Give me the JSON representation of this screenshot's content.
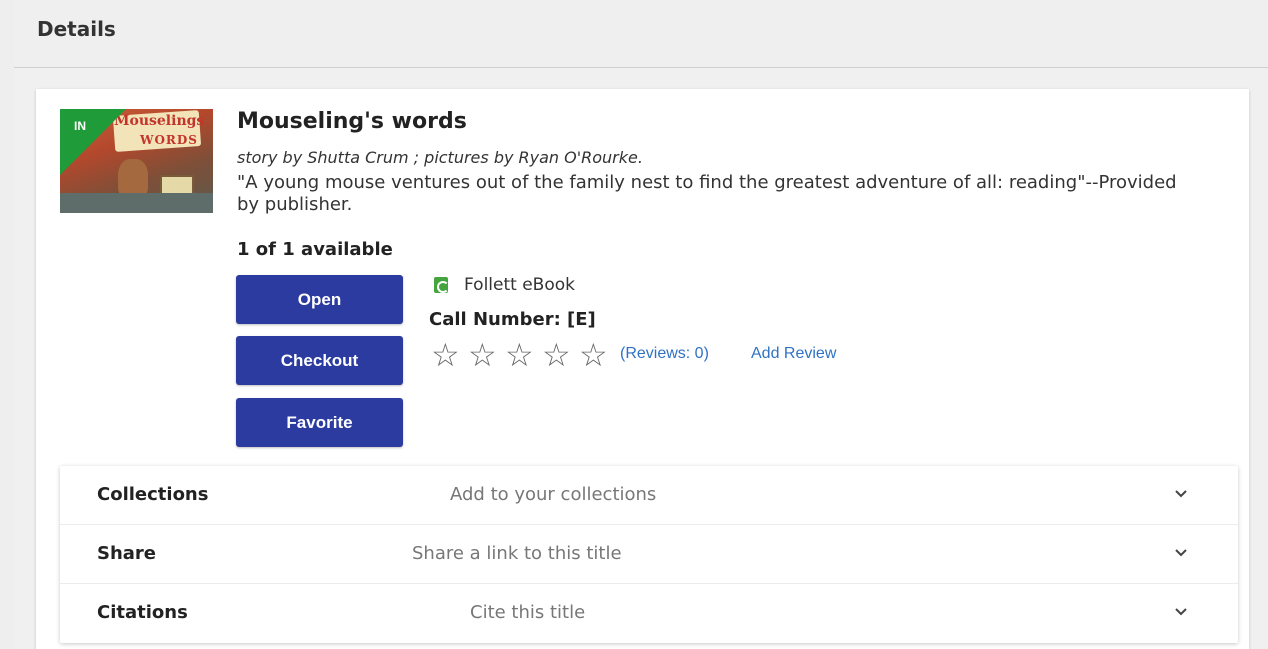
{
  "header": {
    "title": "Details"
  },
  "book": {
    "status_badge": "IN",
    "cover_text_line1": "Mouselings",
    "cover_text_line2": "WORDS",
    "title": "Mouseling's words",
    "byline": "story by Shutta Crum ; pictures by Ryan O'Rourke.",
    "summary": "\"A young mouse ventures out of the family nest to find the greatest adventure of all: reading\"--Provided by publisher.",
    "availability": "1 of 1 available",
    "format": "Follett eBook",
    "call_number": "Call Number: [E]",
    "rating": {
      "stars_filled": 0,
      "stars_total": 5
    },
    "reviews_link": "(Reviews: 0)",
    "add_review_link": "Add Review"
  },
  "actions": {
    "open_label": "Open",
    "checkout_label": "Checkout",
    "favorite_label": "Favorite"
  },
  "accordion": [
    {
      "label": "Collections",
      "description": "Add to your collections",
      "icon": "chevron-down-icon"
    },
    {
      "label": "Share",
      "description": "Share a link to this title",
      "icon": "chevron-down-icon"
    },
    {
      "label": "Citations",
      "description": "Cite this title",
      "icon": "chevron-down-icon"
    }
  ],
  "colors": {
    "button": "#2c3ba0",
    "link": "#2f72c4",
    "badge": "#1f9b3a",
    "ebook_icon": "#44a53f"
  },
  "icons": {
    "star": "star-outline-icon",
    "format": "ebook-icon"
  }
}
